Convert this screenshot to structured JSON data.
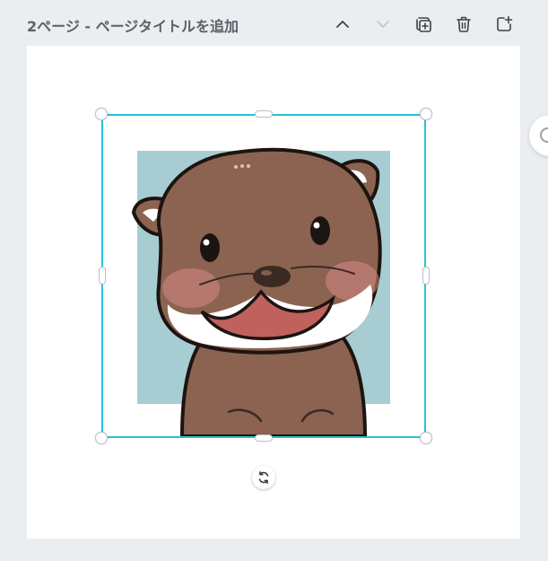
{
  "header": {
    "page_title": "2ページ - ページタイトルを追加"
  },
  "toolbar": [
    {
      "name": "move-page-up-button",
      "icon": "chevron-up-icon",
      "enabled": true
    },
    {
      "name": "move-page-down-button",
      "icon": "chevron-down-icon",
      "enabled": false
    },
    {
      "name": "duplicate-page-button",
      "icon": "duplicate-page-icon",
      "enabled": true
    },
    {
      "name": "delete-page-button",
      "icon": "trash-icon",
      "enabled": true
    },
    {
      "name": "add-page-button",
      "icon": "add-page-icon",
      "enabled": true
    }
  ],
  "selection": {
    "color": "#23c4d8",
    "image_subject": "otter illustration"
  },
  "colors": {
    "background": "#ebeef1",
    "canvas": "#ffffff",
    "image_bg": "#a7cdd3",
    "otter_fur": "#8b6350",
    "title_text": "#5b6168"
  }
}
